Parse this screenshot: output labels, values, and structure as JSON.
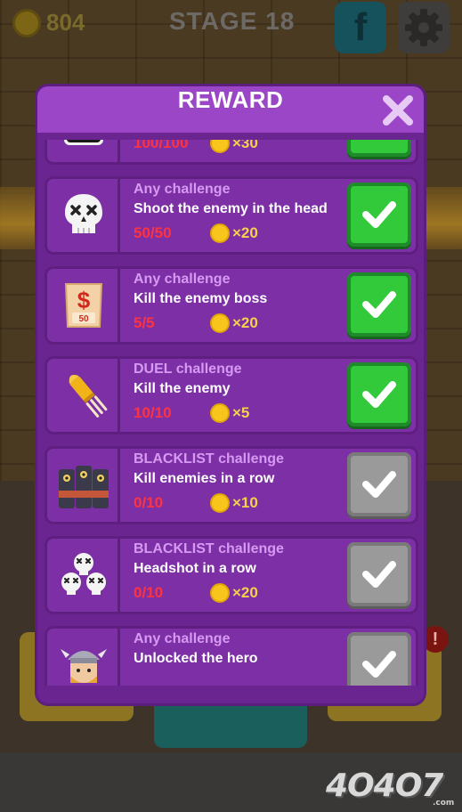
{
  "hud": {
    "coins": "804",
    "stage": "STAGE 18",
    "facebook_label": "f"
  },
  "dialog": {
    "title": "REWARD"
  },
  "challenges": [
    {
      "icon": "mask-icon",
      "category": "",
      "task": "",
      "progress": "100/100",
      "reward": "×30",
      "claimable": true
    },
    {
      "icon": "skull-icon",
      "category": "Any challenge",
      "task": "Shoot the enemy in the head",
      "progress": "50/50",
      "reward": "×20",
      "claimable": true
    },
    {
      "icon": "wanted-poster-icon",
      "category": "Any challenge",
      "task": "Kill the enemy boss",
      "progress": "5/5",
      "reward": "×20",
      "claimable": true
    },
    {
      "icon": "bullet-icon",
      "category": "DUEL challenge",
      "task": "Kill the enemy",
      "progress": "10/10",
      "reward": "×5",
      "claimable": true
    },
    {
      "icon": "masked-enemies-icon",
      "category": "BLACKLIST challenge",
      "task": "Kill enemies in a row",
      "progress": "0/10",
      "reward": "×10",
      "claimable": false
    },
    {
      "icon": "skull-pile-icon",
      "category": "BLACKLIST challenge",
      "task": "Headshot in a row",
      "progress": "0/10",
      "reward": "×20",
      "claimable": false
    },
    {
      "icon": "viking-hero-icon",
      "category": "Any challenge",
      "task": "Unlocked the hero",
      "progress": "",
      "reward": "",
      "claimable": false
    }
  ],
  "background": {
    "alert_badge": "!"
  },
  "watermark": {
    "text": "4O4O7",
    "sub": ".com"
  },
  "colors": {
    "dialog_bg": "#6a2590",
    "header_bg": "#9a46c6",
    "row_bg": "#7d2fa6",
    "category_text": "#d79af3",
    "progress_text": "#ff3340",
    "coin": "#f7c51c",
    "claim_active": "#32c93a",
    "claim_disabled": "#9a9a9a"
  }
}
